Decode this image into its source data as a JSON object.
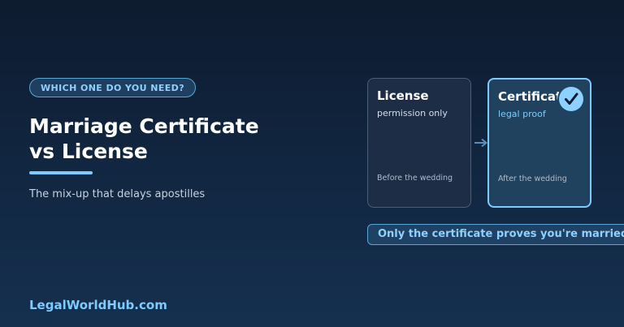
{
  "tag": "WHICH ONE DO YOU NEED?",
  "title": {
    "line1": "Marriage Certificate",
    "line2": "vs License"
  },
  "subtitle": "The mix-up that delays apostilles",
  "brand": "LegalWorldHub.com",
  "cards": {
    "license": {
      "title": "License",
      "subtitle": "permission only",
      "when": "Before the wedding"
    },
    "certificate": {
      "title": "Certificate",
      "subtitle": "legal proof",
      "when": "After the wedding"
    }
  },
  "banner": "Only the certificate proves you're married",
  "icons": {
    "arrow": "arrow-right-icon",
    "check": "checkmark-icon"
  },
  "colors": {
    "accent": "#7ecbff",
    "background_top": "#0d1b2f",
    "background_bottom": "#15304f"
  }
}
